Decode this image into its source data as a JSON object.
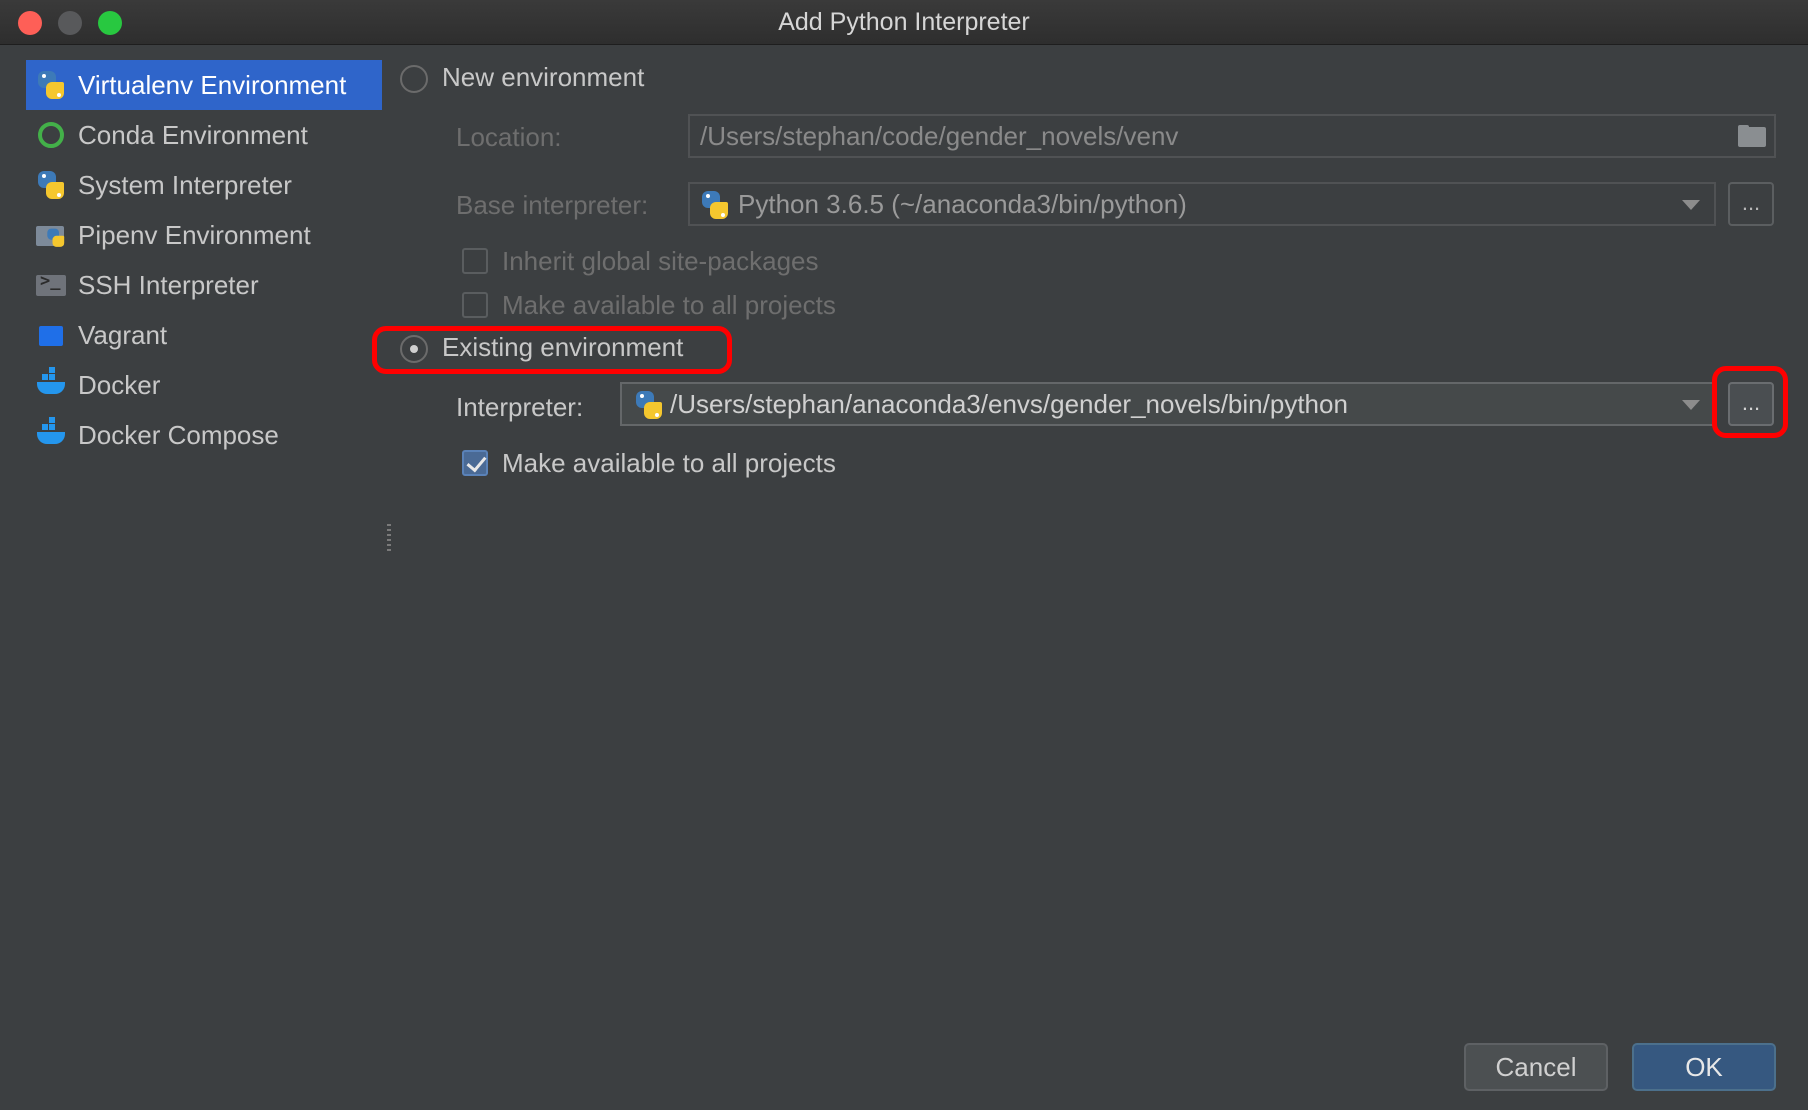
{
  "window": {
    "title": "Add Python Interpreter"
  },
  "sidebar": {
    "items": [
      {
        "label": "Virtualenv Environment",
        "icon": "virtualenv-icon",
        "selected": true
      },
      {
        "label": "Conda Environment",
        "icon": "conda-icon"
      },
      {
        "label": "System Interpreter",
        "icon": "python-icon"
      },
      {
        "label": "Pipenv Environment",
        "icon": "pipenv-icon"
      },
      {
        "label": "SSH Interpreter",
        "icon": "terminal-icon"
      },
      {
        "label": "Vagrant",
        "icon": "vagrant-icon"
      },
      {
        "label": "Docker",
        "icon": "docker-icon"
      },
      {
        "label": "Docker Compose",
        "icon": "docker-compose-icon"
      }
    ]
  },
  "new_env": {
    "radio_label": "New environment",
    "selected": false,
    "location_label": "Location:",
    "location_value": "/Users/stephan/code/gender_novels/venv",
    "base_label": "Base interpreter:",
    "base_value": "Python 3.6.5 (~/anaconda3/bin/python)",
    "browse_label": "...",
    "inherit_label": "Inherit global site-packages",
    "inherit_checked": false,
    "make_available_label": "Make available to all projects",
    "make_available_checked": false
  },
  "existing_env": {
    "radio_label": "Existing environment",
    "selected": true,
    "interpreter_label": "Interpreter:",
    "interpreter_value": "/Users/stephan/anaconda3/envs/gender_novels/bin/python",
    "browse_label": "...",
    "make_available_label": "Make available to all projects",
    "make_available_checked": true
  },
  "buttons": {
    "cancel": "Cancel",
    "ok": "OK"
  },
  "colors": {
    "selection": "#2f65ca",
    "highlight": "#ff0000",
    "ok_button": "#365880",
    "background": "#3c3f41"
  }
}
